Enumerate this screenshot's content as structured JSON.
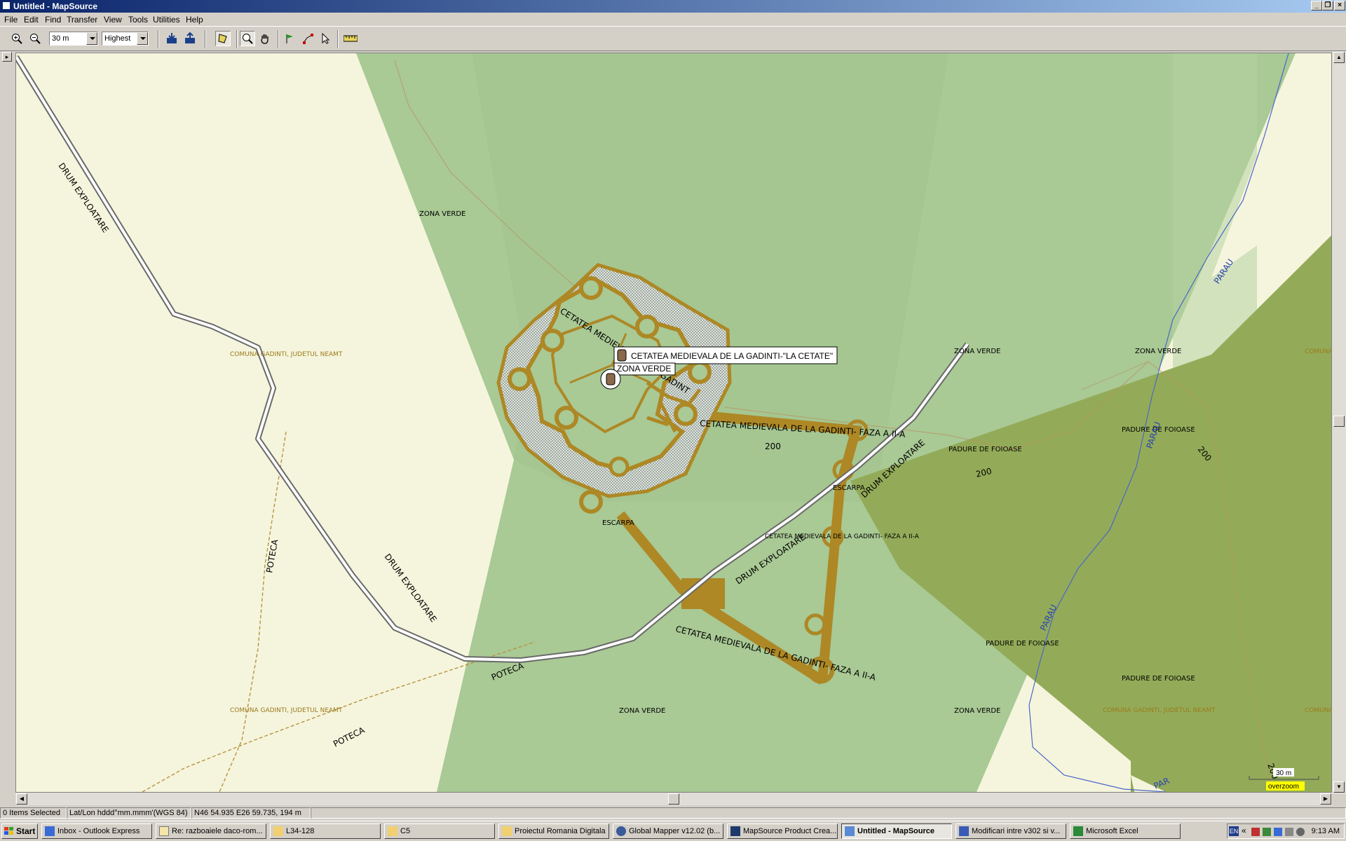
{
  "window": {
    "title": "Untitled - MapSource"
  },
  "menu": [
    "File",
    "Edit",
    "Find",
    "Transfer",
    "View",
    "Tools",
    "Utilities",
    "Help"
  ],
  "toolbar": {
    "zoom_in": "zoom-in-icon",
    "zoom_out": "zoom-out-icon",
    "zoom_value": "30 m",
    "detail_value": "Highest"
  },
  "map": {
    "labels": {
      "zona_verde": "ZONA VERDE",
      "drum": "DRUM EXPLOATARE",
      "comuna": "COMUNA GADINTI, JUDETUL NEAMT",
      "poteca": "POTECA",
      "cetatea": "CETATEA MEDIEVALA DE LA GADINTI",
      "cetatea_faza": "CETATEA MEDIEVALA DE LA GADINTI- FAZA A II-A",
      "escarpa": "ESCARPA",
      "padure": "PADURE DE FOIOASE",
      "parau": "PARAU",
      "contour": "200",
      "comuna_trunc": "COMUNA"
    },
    "tooltip_1": "CETATEA MEDIEVALA DE LA GADINTI-\"LA CETATE\"",
    "tooltip_2": "ZONA VERDE",
    "scale_label": "30 m",
    "overzoom": "overzoom"
  },
  "status": {
    "selected": "0 Items Selected",
    "format": "Lat/Lon hddd°mm.mmm'(WGS 84)",
    "coords": "N46 54.935 E26 59.735, 194 m"
  },
  "taskbar": {
    "start": "Start",
    "tasks": [
      "Inbox - Outlook Express",
      "Re: razboaiele daco-rom...",
      "L34-128",
      "C5",
      "Proiectul Romania Digitala",
      "Global Mapper v12.02 (b...",
      "MapSource Product Crea...",
      "Untitled - MapSource",
      "Modificari intre v302 si v...",
      "Microsoft Excel"
    ],
    "lang": "EN",
    "clock": "9:13 AM"
  },
  "colors": {
    "title_bar": "#0a246a",
    "fortress": "#b08a28",
    "forest": "#93ab58",
    "green_zone": "#a9c995"
  }
}
